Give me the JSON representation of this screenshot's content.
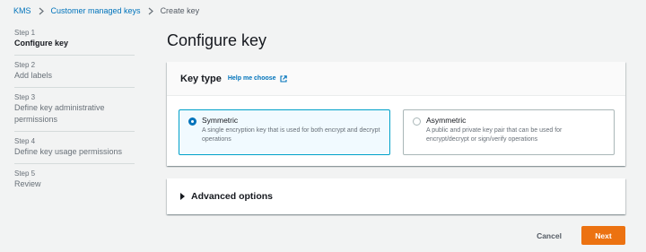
{
  "breadcrumb": {
    "items": [
      "KMS",
      "Customer managed keys"
    ],
    "current": "Create key"
  },
  "steps": [
    {
      "num": "Step 1",
      "title": "Configure key",
      "active": true
    },
    {
      "num": "Step 2",
      "title": "Add labels",
      "active": false
    },
    {
      "num": "Step 3",
      "title": "Define key administrative permissions",
      "active": false
    },
    {
      "num": "Step 4",
      "title": "Define key usage permissions",
      "active": false
    },
    {
      "num": "Step 5",
      "title": "Review",
      "active": false
    }
  ],
  "page_title": "Configure key",
  "key_type": {
    "title": "Key type",
    "help_link": "Help me choose",
    "options": [
      {
        "label": "Symmetric",
        "description": "A single encryption key that is used for both encrypt and decrypt operations",
        "selected": true
      },
      {
        "label": "Asymmetric",
        "description": "A public and private key pair that can be used for encrypt/decrypt or sign/verify operations",
        "selected": false
      }
    ]
  },
  "advanced": {
    "title": "Advanced options"
  },
  "actions": {
    "cancel_label": "Cancel",
    "next_label": "Next"
  },
  "colors": {
    "link": "#0073bb",
    "primary": "#ec7211",
    "selected_border": "#00a1c9",
    "background": "#f2f3f3"
  }
}
